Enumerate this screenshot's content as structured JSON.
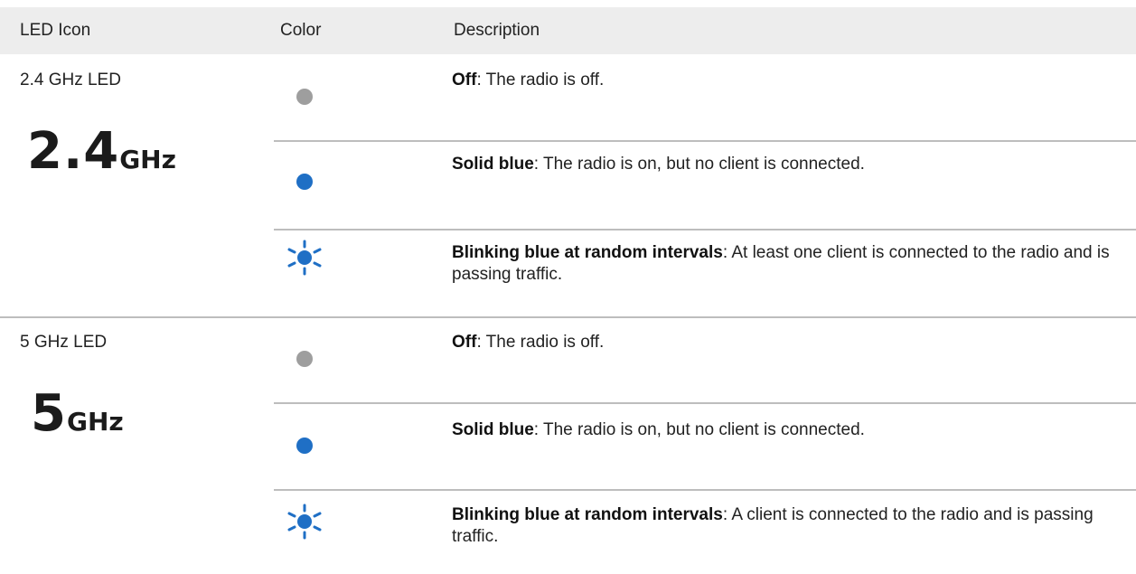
{
  "header": {
    "col_icon": "LED Icon",
    "col_color": "Color",
    "col_description": "Description"
  },
  "colors": {
    "off": "#9e9e9e",
    "blue": "#1f6fc5",
    "header_bg": "#ededed"
  },
  "groups": [
    {
      "name": "2.4 GHz LED",
      "icon_number": "2.4",
      "icon_unit": "GHz",
      "states": [
        {
          "icon": "gray-dot-icon",
          "label": "Off",
          "text": ": The radio is off."
        },
        {
          "icon": "blue-dot-icon",
          "label": "Solid blue",
          "text": ": The radio is on, but no client is connected."
        },
        {
          "icon": "blinking-blue-icon",
          "label": "Blinking blue at random intervals",
          "text": ": At least one client is connected to the radio and is passing traffic."
        }
      ]
    },
    {
      "name": "5 GHz LED",
      "icon_number": "5",
      "icon_unit": "GHz",
      "states": [
        {
          "icon": "gray-dot-icon",
          "label": "Off",
          "text": ": The radio is off."
        },
        {
          "icon": "blue-dot-icon",
          "label": "Solid blue",
          "text": ": The radio is on, but no client is connected."
        },
        {
          "icon": "blinking-blue-icon",
          "label": "Blinking blue at random intervals",
          "text": ": A client is connected to the radio and is passing traffic."
        }
      ]
    }
  ]
}
